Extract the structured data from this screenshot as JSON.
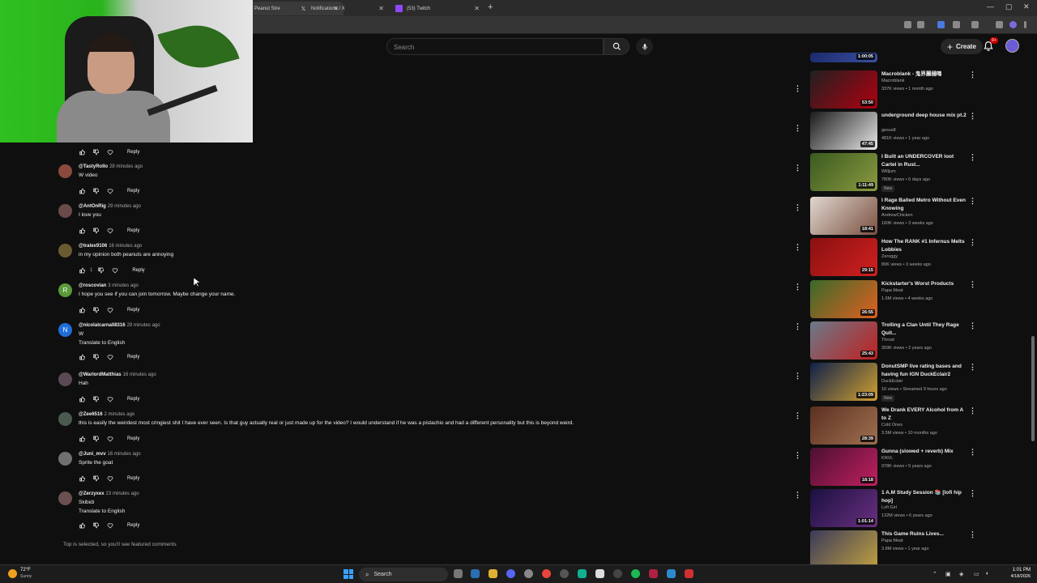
{
  "browser": {
    "tabs": [
      {
        "title": "Peanut Stre",
        "icon": "youtube-icon",
        "active": true
      },
      {
        "title": "Notifications / X",
        "icon": "x-icon",
        "active": false
      },
      {
        "title": "(53) Twitch",
        "icon": "twitch-icon",
        "active": false
      }
    ],
    "new_tab": "+"
  },
  "header": {
    "search_placeholder": "Search",
    "create_label": "Create",
    "notification_badge": "9+"
  },
  "comments": [
    {
      "author": "@TastyRollo",
      "time": "28 minutes ago",
      "text": "W video",
      "avatar_color": "#8a4b3c",
      "avatar_letter": "",
      "translate": "",
      "likes": ""
    },
    {
      "author": "@AntOnRig",
      "time": "29 minutes ago",
      "text": "I love you",
      "avatar_color": "#6b4a4a",
      "avatar_letter": "",
      "translate": "",
      "likes": ""
    },
    {
      "author": "@tralex9106",
      "time": "16 minutes ago",
      "text": "in my opinion both peanuts are annoying",
      "avatar_color": "#6a5a30",
      "avatar_letter": "",
      "translate": "",
      "likes": "1"
    },
    {
      "author": "@roscovian",
      "time": "3 minutes ago",
      "text": "I hope you see if you can join tomorrow. Maybe change your name.",
      "avatar_color": "#5a9a3a",
      "avatar_letter": "R",
      "translate": "",
      "likes": ""
    },
    {
      "author": "@nicolalcarnall8316",
      "time": "29 minutes ago",
      "text": "W",
      "avatar_color": "#1e6fd9",
      "avatar_letter": "N",
      "translate": "Translate to English",
      "likes": ""
    },
    {
      "author": "@WarlordMatthias",
      "time": "16 minutes ago",
      "text": "Hah",
      "avatar_color": "#5a4a55",
      "avatar_letter": "",
      "translate": "",
      "likes": ""
    },
    {
      "author": "@Zee6516",
      "time": "2 minutes ago",
      "text": "this is easily the weirdest most cringiest shit I have ever seen. Is that guy actually real or just made up for the video? I would understand if he was a pistachio and had a different personality but this is beyond weird.",
      "avatar_color": "#4a5a50",
      "avatar_letter": "",
      "translate": "",
      "likes": ""
    },
    {
      "author": "@Juni_mvv",
      "time": "16 minutes ago",
      "text": "Sprite the goat",
      "avatar_color": "#707070",
      "avatar_letter": "",
      "translate": "",
      "likes": ""
    },
    {
      "author": "@Zerzyxex",
      "time": "23 minutes ago",
      "text": "Skibidi",
      "avatar_color": "#6a5050",
      "avatar_letter": "",
      "translate": "Translate to English",
      "likes": ""
    }
  ],
  "reply_label": "Reply",
  "featured_note": "Top is selected, so you'll see featured comments",
  "sidebar": [
    {
      "title": "",
      "channel": "",
      "meta": "",
      "duration": "1:00:05",
      "colors": [
        "#1b2a6b",
        "#3a4fa0"
      ],
      "new": ""
    },
    {
      "title": "Macroblank - 鬼界麗樋鳴",
      "channel": "Macroblank",
      "meta": "337K views • 1 month ago",
      "duration": "53:50",
      "colors": [
        "#202020",
        "#b00010"
      ],
      "new": ""
    },
    {
      "title": "underground deep house mix pt.2",
      "channel": "gesus8",
      "meta": "481K views • 1 year ago",
      "duration": "47:45",
      "colors": [
        "#1a1a1a",
        "#e8e8e8"
      ],
      "new": ""
    },
    {
      "title": "I Built an UNDERCOVER loot Cartel in Rust...",
      "channel": "Willjum",
      "meta": "780K views • 6 days ago",
      "duration": "1:11:49",
      "colors": [
        "#3a5a20",
        "#8a9a40"
      ],
      "new": "New"
    },
    {
      "title": "I Rage Baited Metro Without Even Knowing",
      "channel": "AndrewChicken",
      "meta": "160K views • 3 weeks ago",
      "duration": "18:41",
      "colors": [
        "#e0d8d0",
        "#7a5040"
      ],
      "new": ""
    },
    {
      "title": "How The RANK #1 Infernus Melts Lobbies",
      "channel": "Zeroggy",
      "meta": "80K views • 3 weeks ago",
      "duration": "29:15",
      "colors": [
        "#8a1010",
        "#d02020"
      ],
      "new": ""
    },
    {
      "title": "Kickstarter's Worst Products",
      "channel": "Papa Meat",
      "meta": "1.6M views • 4 weeks ago",
      "duration": "26:55",
      "colors": [
        "#3a6a2a",
        "#e06020"
      ],
      "new": ""
    },
    {
      "title": "Trolling a Clan Until They Rage Quit...",
      "channel": "Throat",
      "meta": "359K views • 2 years ago",
      "duration": "25:43",
      "colors": [
        "#6a7a8a",
        "#c02020"
      ],
      "new": ""
    },
    {
      "title": "DonutSMP live rating bases and having fun IGN DuckEclair2",
      "channel": "DuckEclair",
      "meta": "16 views • Streamed 9 hours ago",
      "duration": "1:23:09",
      "colors": [
        "#10204a",
        "#d0a030"
      ],
      "new": "New"
    },
    {
      "title": "We Drank EVERY Alcohol from A to Z",
      "channel": "Cold Ones",
      "meta": "3.5M views • 10 months ago",
      "duration": "28:39",
      "colors": [
        "#5a3020",
        "#a07050"
      ],
      "new": ""
    },
    {
      "title": "Gunna (slowed + reverb) Mix",
      "channel": "KNVL",
      "meta": "978K views • 5 years ago",
      "duration": "18:18",
      "colors": [
        "#4a1030",
        "#c02060"
      ],
      "new": ""
    },
    {
      "title": "1 A.M Study Session 📚 [lofi hip hop]",
      "channel": "Lofi Girl",
      "meta": "132M views • 6 years ago",
      "duration": "1:01:14",
      "colors": [
        "#1a1040",
        "#6a3080"
      ],
      "new": ""
    },
    {
      "title": "This Game Ruins Lives...",
      "channel": "Papa Meat",
      "meta": "3.8M views • 1 year ago",
      "duration": "",
      "colors": [
        "#3a3a5a",
        "#c0a040"
      ],
      "new": ""
    }
  ],
  "taskbar": {
    "weather_temp": "72°F",
    "weather_cond": "Sunny",
    "search_label": "Search",
    "time": "1:01 PM",
    "date": "4/18/2026"
  }
}
